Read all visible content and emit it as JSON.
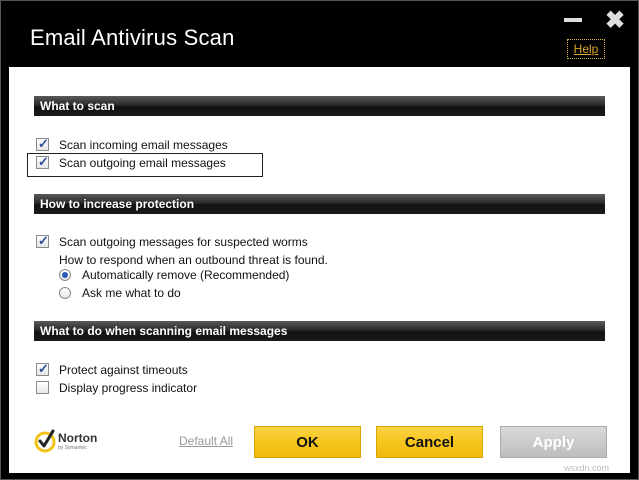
{
  "window": {
    "title": "Email Antivirus Scan",
    "help_label": "Help",
    "close_glyph": "✖"
  },
  "sections": {
    "what_to_scan": {
      "header": "What to scan",
      "items": [
        {
          "label": "Scan incoming email messages",
          "checked": true
        },
        {
          "label": "Scan outgoing email messages",
          "checked": true
        }
      ]
    },
    "increase_protection": {
      "header": "How to increase protection",
      "worms_label": "Scan outgoing messages for suspected worms",
      "worms_checked": true,
      "respond_text": "How to respond when an outbound threat is found.",
      "options": [
        {
          "label": "Automatically remove (Recommended)",
          "selected": true
        },
        {
          "label": "Ask me what to do",
          "selected": false
        }
      ]
    },
    "when_scanning": {
      "header": "What to do when scanning email messages",
      "items": [
        {
          "label": "Protect against timeouts",
          "checked": true
        },
        {
          "label": "Display progress indicator",
          "checked": false
        }
      ]
    }
  },
  "footer": {
    "logo_name": "Norton",
    "logo_by": "by Symantec",
    "default_label": "Default All",
    "ok_label": "OK",
    "cancel_label": "Cancel",
    "apply_label": "Apply"
  },
  "watermark": "wsxdn.com",
  "colors": {
    "accent_gold": "#f6c61f",
    "header_dark": "#1a1a1a",
    "check_blue": "#2b4e9a"
  }
}
